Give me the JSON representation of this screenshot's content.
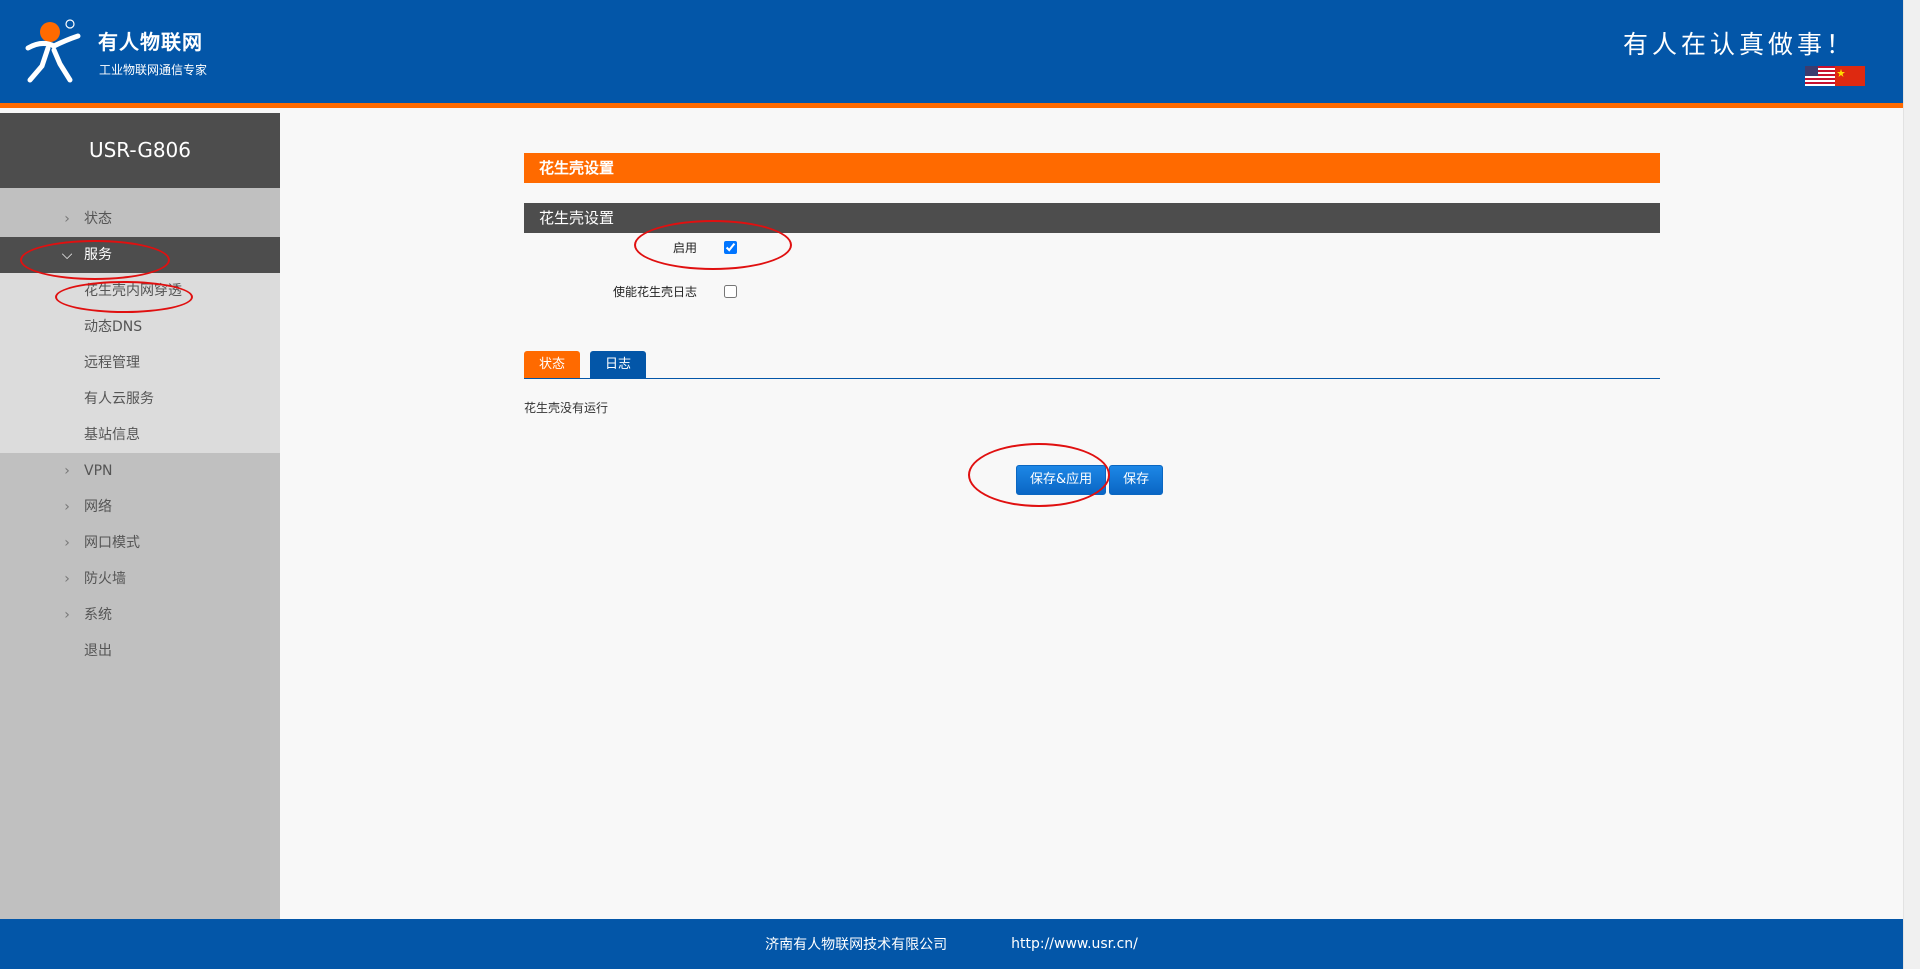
{
  "header": {
    "brand_name": "有人物联网",
    "brand_sub": "工业物联网通信专家",
    "slogan": "有人在认真做事！",
    "flags": [
      "us-flag-icon",
      "china-flag-icon"
    ]
  },
  "sidebar": {
    "device_name": "USR-G806",
    "menu": [
      {
        "label": "状态"
      },
      {
        "label": "服务",
        "active": true
      },
      {
        "label": "VPN"
      },
      {
        "label": "网络"
      },
      {
        "label": "网口模式"
      },
      {
        "label": "防火墙"
      },
      {
        "label": "系统"
      },
      {
        "label": "退出"
      }
    ],
    "submenu": [
      {
        "label": "花生壳内网穿透"
      },
      {
        "label": "动态DNS"
      },
      {
        "label": "远程管理"
      },
      {
        "label": "有人云服务"
      },
      {
        "label": "基站信息"
      }
    ]
  },
  "main": {
    "page_title": "花生壳设置",
    "section_title": "花生壳设置",
    "fields": {
      "enable_label": "启用",
      "enable_checked": true,
      "log_label": "使能花生壳日志",
      "log_checked": false
    },
    "tabs": [
      {
        "label": "状态"
      },
      {
        "label": "日志"
      }
    ],
    "status_text": "花生壳没有运行",
    "buttons": {
      "save_apply": "保存&应用",
      "save": "保存"
    }
  },
  "footer": {
    "company": "济南有人物联网技术有限公司",
    "url": "http://www.usr.cn/"
  },
  "colors": {
    "header_blue": "#0356a8",
    "accent_orange": "#ff6a00",
    "dark_gray": "#4d4d4d",
    "sidebar_gray": "#c0c0c0",
    "annotation_red": "#e01010"
  }
}
